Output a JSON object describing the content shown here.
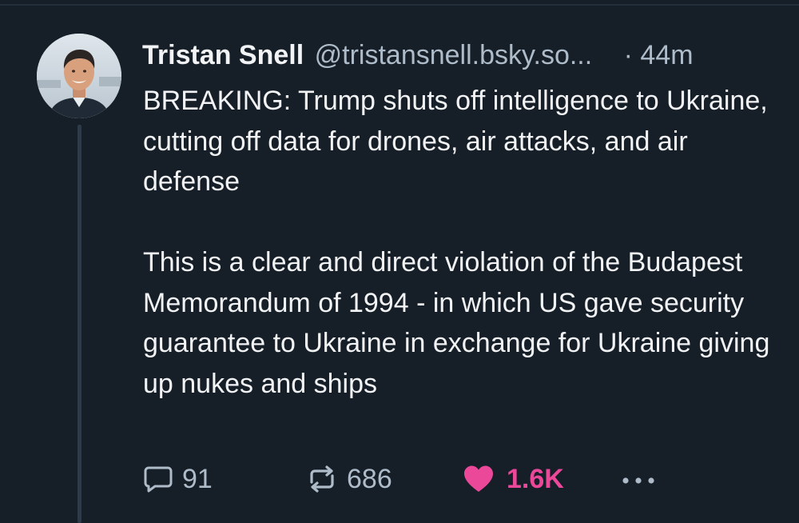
{
  "post": {
    "author_name": "Tristan Snell",
    "author_handle": "@tristansnell.bsky.so...",
    "timestamp": "· 44m",
    "text": "BREAKING: Trump shuts off intelligence to Ukraine, cutting off data for drones, air attacks, and air defense\n\nThis is a clear and direct violation of the Budapest Memorandum of 1994 - in which US gave security guarantee to Ukraine in exchange for Ukraine giving up nukes and ships"
  },
  "actions": {
    "reply": {
      "icon": "speech-bubble-icon",
      "count": "91"
    },
    "repost": {
      "icon": "repost-arrows-icon",
      "count": "686"
    },
    "like": {
      "icon": "heart-icon",
      "count": "1.6K",
      "liked": true
    },
    "more": {
      "icon": "ellipsis-icon"
    }
  },
  "colors": {
    "background": "#161e27",
    "primary_text": "#f1f3f5",
    "secondary_text": "#aebbc9",
    "like_accent": "#ec4899",
    "thread_line": "#2c3a4b"
  }
}
